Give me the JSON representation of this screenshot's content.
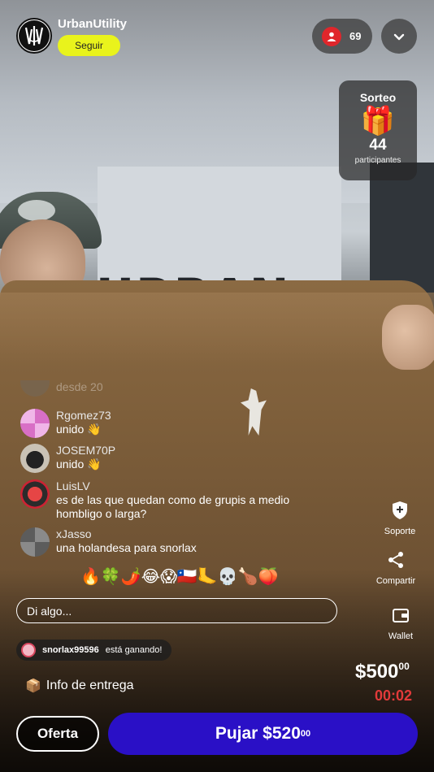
{
  "host": {
    "name": "UrbanUtility",
    "follow_label": "Seguir",
    "avatar": "logo-avatar"
  },
  "viewers": {
    "count": "69",
    "icon": "user-icon",
    "accent": "#e0262b"
  },
  "menu": {
    "icon": "chevron-down-icon"
  },
  "giveaway": {
    "title": "Sorteo",
    "icon": "gift-icon",
    "count": "44",
    "label": "participantes"
  },
  "scene": {
    "sign_text": "URBAN"
  },
  "chat": {
    "messages": [
      {
        "user": "",
        "text": "desde 20",
        "faded": true
      },
      {
        "user": "Rgomez73",
        "text": "unido 👋"
      },
      {
        "user": "JOSEM70P",
        "text": "unido 👋"
      },
      {
        "user": "LuisLV",
        "text": "es de las que quedan como de grupis a medio hombligo o larga?"
      },
      {
        "user": "xJasso",
        "text": "una holandesa para snorlax"
      }
    ]
  },
  "reactions": "🔥🍀🌶️😂😱🇨🇱🦶💀🍗🍑",
  "comment": {
    "placeholder": "Di algo..."
  },
  "winner": {
    "user": "snorlax99596",
    "text": "está ganando!"
  },
  "delivery": {
    "icon": "package-icon",
    "label": "Info de entrega"
  },
  "actions": {
    "support": {
      "label": "Soporte",
      "icon": "shield-plus-icon"
    },
    "share": {
      "label": "Compartir",
      "icon": "share-icon"
    },
    "wallet": {
      "label": "Wallet",
      "icon": "wallet-icon"
    }
  },
  "auction": {
    "price_main": "$500",
    "price_cents": "00",
    "timer": "00:02",
    "timer_color": "#e23a3a",
    "offer_label": "Oferta",
    "bid_main": "Pujar $520",
    "bid_cents": "00",
    "bid_color": "#2a10c6"
  }
}
